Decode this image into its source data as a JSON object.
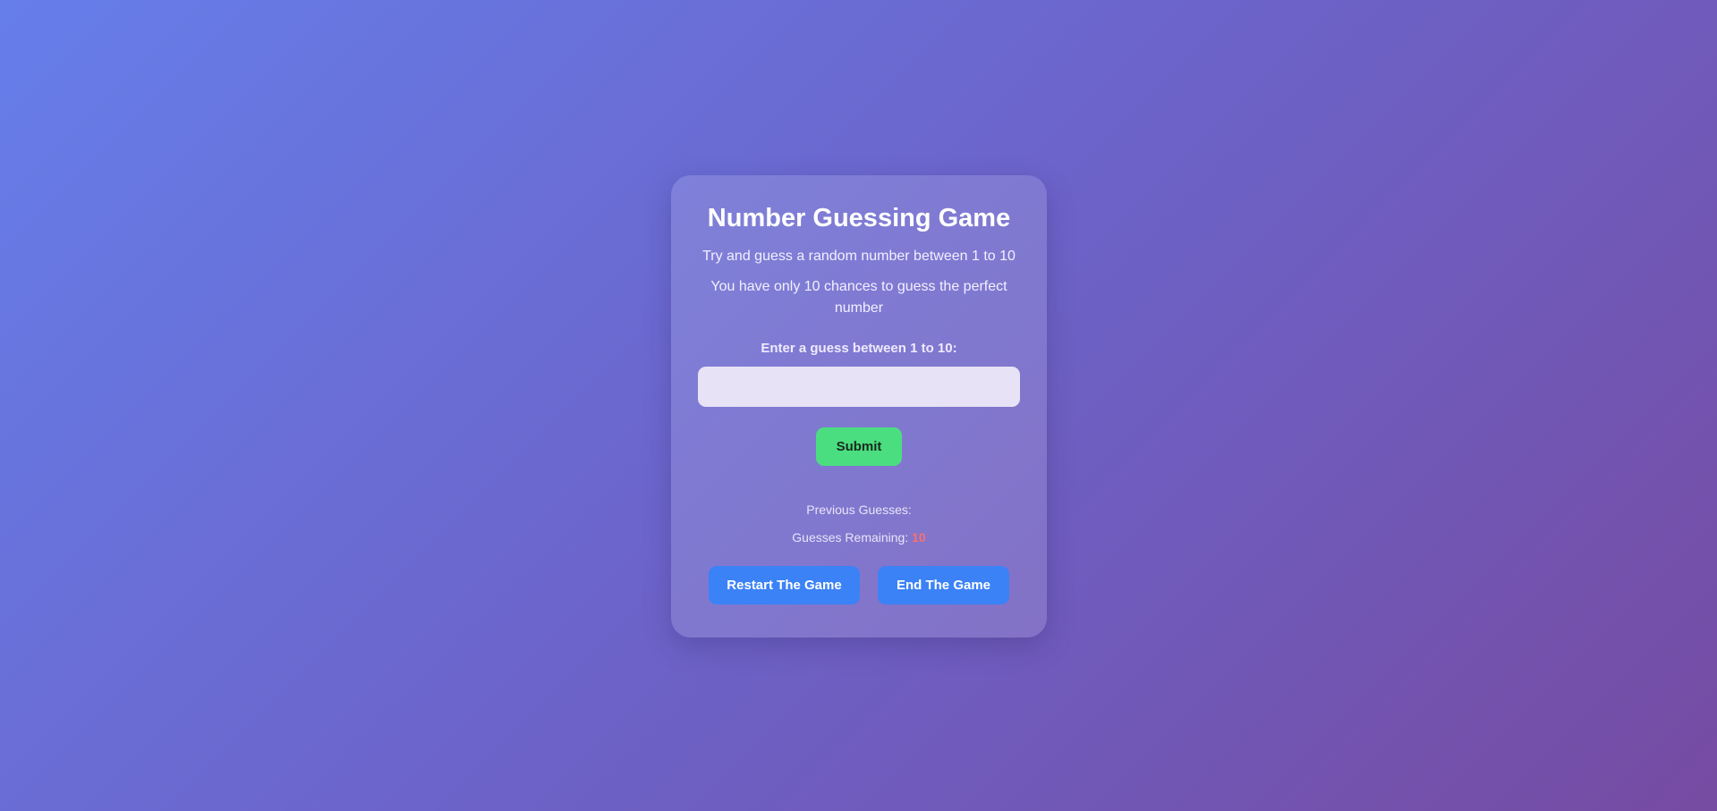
{
  "game": {
    "title": "Number Guessing Game",
    "subtitle": "Try and guess a random number between 1 to 10",
    "chances_text": "You have only 10 chances to guess the perfect number",
    "input_label": "Enter a guess between 1 to 10:",
    "input_value": "",
    "submit_label": "Submit",
    "previous_guesses_label": "Previous Guesses:",
    "remaining_label": "Guesses Remaining:",
    "remaining_count": "10",
    "restart_label": "Restart The Game",
    "end_label": "End The Game"
  },
  "colors": {
    "submit": "#4ade80",
    "action": "#3b82f6",
    "remaining_count": "#f87171"
  }
}
